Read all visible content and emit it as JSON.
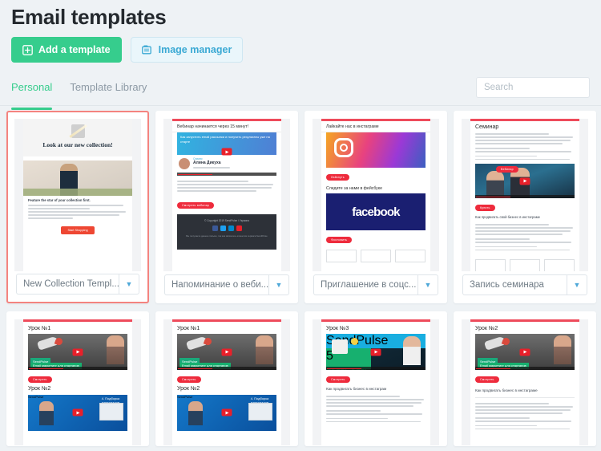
{
  "header": {
    "title": "Email templates",
    "buttons": [
      {
        "label": "Add a template",
        "icon": "plus-square-icon",
        "style": "primary"
      },
      {
        "label": "Image manager",
        "icon": "images-icon",
        "style": "secondary"
      }
    ]
  },
  "tabs": [
    {
      "label": "Personal",
      "active": true
    },
    {
      "label": "Template Library",
      "active": false
    }
  ],
  "search": {
    "placeholder": "Search",
    "value": ""
  },
  "colors": {
    "accent_green": "#36cd8d",
    "accent_blue": "#3aa9d4",
    "selected_border": "#f4837f",
    "email_top_bar": "#ee4b5b",
    "page_bg": "#eef2f5"
  },
  "templates": [
    {
      "name": "New Collection Templ...",
      "selected": true,
      "preview_kind": "collection",
      "preview": {
        "heading": "Look at our new collection!",
        "body_heading": "Feature the star of your collection first.",
        "cta": "Start Shopping"
      }
    },
    {
      "name": "Напоминание о веби...",
      "selected": false,
      "preview_kind": "webinar",
      "preview": {
        "subject": "Вебинар начинается через 15 минут!",
        "banner": "Как запустить email рассылки и получить результаты уже на старте",
        "speaker_role": "Спикер",
        "speaker_name": "Алина Дикуха",
        "cta": "Смотреть вебинар",
        "footer": "© Copyright 2019 SendPulse / Украина",
        "footer_note": "Вы получаете данное письмо, так как являетесь клиентом сервиса SendPulse"
      }
    },
    {
      "name": "Приглашение в соцс...",
      "selected": false,
      "preview_kind": "social",
      "preview": {
        "heading_ig": "Лайкайте нас в инстаграме",
        "cta_ig": "Лайкнуть",
        "heading_fb": "Следите за нами в фейсбуке",
        "fb_logo_text": "facebook",
        "cta_fb": "Фолловить"
      }
    },
    {
      "name": "Запись семинара",
      "selected": false,
      "preview_kind": "seminar",
      "preview": {
        "heading": "Семинар",
        "badge": "Вебинар",
        "cta": "Купить",
        "section_heading": "Как продвигать свой бизнес в инстаграме"
      }
    },
    {
      "name": "",
      "selected": false,
      "preview_kind": "lesson-rocket-1",
      "preview": {
        "heading_1": "Урок №1",
        "video_label_brand": "SendPulse",
        "video_label_text": "Email маркетинг для стартапов",
        "cta": "Смотреть",
        "heading_2": "Урок №2"
      }
    },
    {
      "name": "",
      "selected": false,
      "preview_kind": "lesson-rocket-2",
      "preview": {
        "heading_1": "Урок №1",
        "video_label_brand": "SendPulse",
        "video_label_text": "Email маркетинг для стартапов",
        "cta": "Смотреть",
        "heading_2": "Урок №2"
      }
    },
    {
      "name": "",
      "selected": false,
      "preview_kind": "lesson-calendar-3",
      "preview": {
        "heading_1": "Урок №3",
        "video_label_brand": "SendPulse",
        "video_label_text": "5 контент-идей для январских рассылок",
        "cta": "Смотреть",
        "section_heading": "Как продвигать бизнес в инстаграм"
      }
    },
    {
      "name": "",
      "selected": false,
      "preview_kind": "lesson-rocket-3",
      "preview": {
        "heading_1": "Урок №2",
        "video_label_brand": "SendPulse",
        "video_label_text": "Email маркетинг для стартапов",
        "cta": "Смотреть",
        "section_heading": "Как продвигать бизнес в инстаграме"
      }
    }
  ]
}
